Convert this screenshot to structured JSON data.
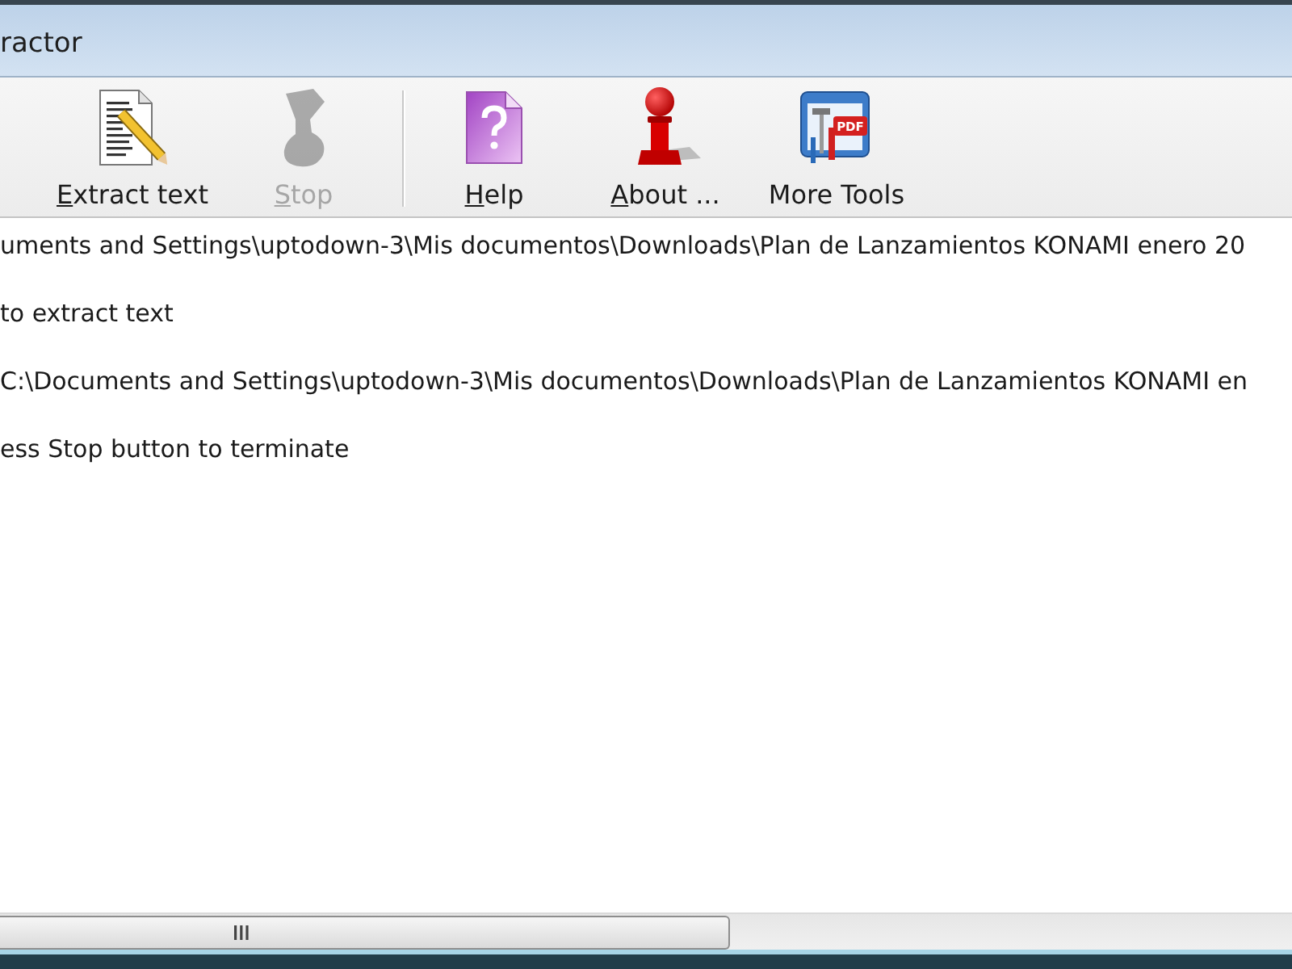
{
  "window": {
    "title": "ractor"
  },
  "toolbar": {
    "groups": [
      [
        {
          "kind": "extract",
          "label": "Extract text",
          "access_key_underlined": true,
          "disabled": false
        },
        {
          "kind": "stop",
          "label": "Stop",
          "access_key_underlined": true,
          "disabled": true
        }
      ],
      [
        {
          "kind": "help",
          "label": "Help",
          "access_key_underlined": true,
          "disabled": false
        },
        {
          "kind": "about",
          "label": "About ...",
          "access_key_underlined": true,
          "disabled": false
        },
        {
          "kind": "tools",
          "label": "More Tools",
          "access_key_underlined": false,
          "disabled": false,
          "badge": "PDF"
        }
      ]
    ]
  },
  "log": {
    "lines": [
      "uments and Settings\\uptodown-3\\Mis documentos\\Downloads\\Plan de Lanzamientos KONAMI enero 20",
      "to extract text",
      "C:\\Documents and Settings\\uptodown-3\\Mis documentos\\Downloads\\Plan de Lanzamientos KONAMI en",
      "ess Stop button to terminate"
    ]
  }
}
